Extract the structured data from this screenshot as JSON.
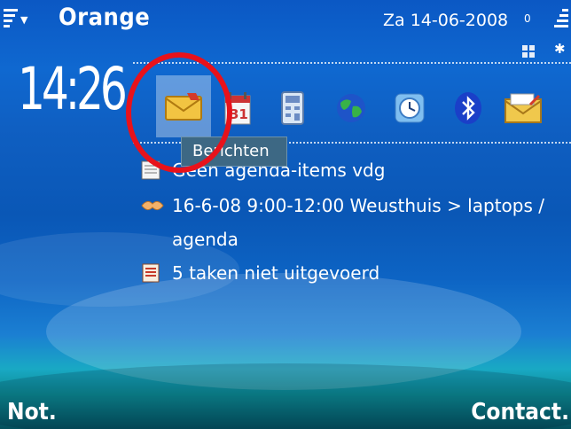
{
  "status": {
    "operator": "Orange",
    "date": "Za 14-06-2008",
    "battery_label": "0",
    "bluetooth_status_icon": "bluetooth-status-icon"
  },
  "clock": "14:26",
  "shortcuts": [
    {
      "name": "Berichten",
      "icon": "envelope-icon"
    },
    {
      "name": "",
      "icon": "calendar-icon"
    },
    {
      "name": "",
      "icon": "calculator-icon"
    },
    {
      "name": "",
      "icon": "globe-icon"
    },
    {
      "name": "",
      "icon": "clock-icon"
    },
    {
      "name": "",
      "icon": "bluetooth-icon"
    },
    {
      "name": "",
      "icon": "mail-icon"
    }
  ],
  "tooltip": "Berichten",
  "agenda": {
    "row1": "Geen agenda-items vdg",
    "row2_line1": "16-6-08 9:00-12:00 Weusthuis > laptops /",
    "row2_line2": "agenda",
    "row3": "5 taken niet uitgevoerd"
  },
  "softkeys": {
    "left": "Not.",
    "right": "Contact."
  },
  "colors": {
    "annotation_circle": "#e8121b",
    "background_top": "#0b58c4",
    "background_bottom": "#044f5c"
  }
}
